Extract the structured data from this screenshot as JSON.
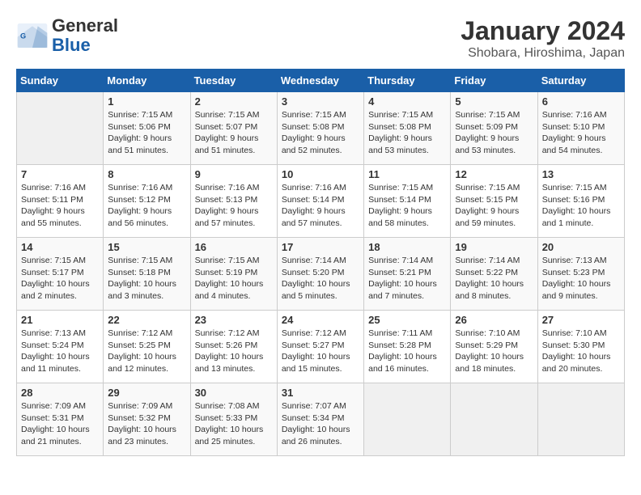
{
  "logo": {
    "text_general": "General",
    "text_blue": "Blue"
  },
  "title": "January 2024",
  "location": "Shobara, Hiroshima, Japan",
  "days_of_week": [
    "Sunday",
    "Monday",
    "Tuesday",
    "Wednesday",
    "Thursday",
    "Friday",
    "Saturday"
  ],
  "weeks": [
    [
      {
        "day": "",
        "sunrise": "",
        "sunset": "",
        "daylight": ""
      },
      {
        "day": "1",
        "sunrise": "Sunrise: 7:15 AM",
        "sunset": "Sunset: 5:06 PM",
        "daylight": "Daylight: 9 hours and 51 minutes."
      },
      {
        "day": "2",
        "sunrise": "Sunrise: 7:15 AM",
        "sunset": "Sunset: 5:07 PM",
        "daylight": "Daylight: 9 hours and 51 minutes."
      },
      {
        "day": "3",
        "sunrise": "Sunrise: 7:15 AM",
        "sunset": "Sunset: 5:08 PM",
        "daylight": "Daylight: 9 hours and 52 minutes."
      },
      {
        "day": "4",
        "sunrise": "Sunrise: 7:15 AM",
        "sunset": "Sunset: 5:08 PM",
        "daylight": "Daylight: 9 hours and 53 minutes."
      },
      {
        "day": "5",
        "sunrise": "Sunrise: 7:15 AM",
        "sunset": "Sunset: 5:09 PM",
        "daylight": "Daylight: 9 hours and 53 minutes."
      },
      {
        "day": "6",
        "sunrise": "Sunrise: 7:16 AM",
        "sunset": "Sunset: 5:10 PM",
        "daylight": "Daylight: 9 hours and 54 minutes."
      }
    ],
    [
      {
        "day": "7",
        "sunrise": "Sunrise: 7:16 AM",
        "sunset": "Sunset: 5:11 PM",
        "daylight": "Daylight: 9 hours and 55 minutes."
      },
      {
        "day": "8",
        "sunrise": "Sunrise: 7:16 AM",
        "sunset": "Sunset: 5:12 PM",
        "daylight": "Daylight: 9 hours and 56 minutes."
      },
      {
        "day": "9",
        "sunrise": "Sunrise: 7:16 AM",
        "sunset": "Sunset: 5:13 PM",
        "daylight": "Daylight: 9 hours and 57 minutes."
      },
      {
        "day": "10",
        "sunrise": "Sunrise: 7:16 AM",
        "sunset": "Sunset: 5:14 PM",
        "daylight": "Daylight: 9 hours and 57 minutes."
      },
      {
        "day": "11",
        "sunrise": "Sunrise: 7:15 AM",
        "sunset": "Sunset: 5:14 PM",
        "daylight": "Daylight: 9 hours and 58 minutes."
      },
      {
        "day": "12",
        "sunrise": "Sunrise: 7:15 AM",
        "sunset": "Sunset: 5:15 PM",
        "daylight": "Daylight: 9 hours and 59 minutes."
      },
      {
        "day": "13",
        "sunrise": "Sunrise: 7:15 AM",
        "sunset": "Sunset: 5:16 PM",
        "daylight": "Daylight: 10 hours and 1 minute."
      }
    ],
    [
      {
        "day": "14",
        "sunrise": "Sunrise: 7:15 AM",
        "sunset": "Sunset: 5:17 PM",
        "daylight": "Daylight: 10 hours and 2 minutes."
      },
      {
        "day": "15",
        "sunrise": "Sunrise: 7:15 AM",
        "sunset": "Sunset: 5:18 PM",
        "daylight": "Daylight: 10 hours and 3 minutes."
      },
      {
        "day": "16",
        "sunrise": "Sunrise: 7:15 AM",
        "sunset": "Sunset: 5:19 PM",
        "daylight": "Daylight: 10 hours and 4 minutes."
      },
      {
        "day": "17",
        "sunrise": "Sunrise: 7:14 AM",
        "sunset": "Sunset: 5:20 PM",
        "daylight": "Daylight: 10 hours and 5 minutes."
      },
      {
        "day": "18",
        "sunrise": "Sunrise: 7:14 AM",
        "sunset": "Sunset: 5:21 PM",
        "daylight": "Daylight: 10 hours and 7 minutes."
      },
      {
        "day": "19",
        "sunrise": "Sunrise: 7:14 AM",
        "sunset": "Sunset: 5:22 PM",
        "daylight": "Daylight: 10 hours and 8 minutes."
      },
      {
        "day": "20",
        "sunrise": "Sunrise: 7:13 AM",
        "sunset": "Sunset: 5:23 PM",
        "daylight": "Daylight: 10 hours and 9 minutes."
      }
    ],
    [
      {
        "day": "21",
        "sunrise": "Sunrise: 7:13 AM",
        "sunset": "Sunset: 5:24 PM",
        "daylight": "Daylight: 10 hours and 11 minutes."
      },
      {
        "day": "22",
        "sunrise": "Sunrise: 7:12 AM",
        "sunset": "Sunset: 5:25 PM",
        "daylight": "Daylight: 10 hours and 12 minutes."
      },
      {
        "day": "23",
        "sunrise": "Sunrise: 7:12 AM",
        "sunset": "Sunset: 5:26 PM",
        "daylight": "Daylight: 10 hours and 13 minutes."
      },
      {
        "day": "24",
        "sunrise": "Sunrise: 7:12 AM",
        "sunset": "Sunset: 5:27 PM",
        "daylight": "Daylight: 10 hours and 15 minutes."
      },
      {
        "day": "25",
        "sunrise": "Sunrise: 7:11 AM",
        "sunset": "Sunset: 5:28 PM",
        "daylight": "Daylight: 10 hours and 16 minutes."
      },
      {
        "day": "26",
        "sunrise": "Sunrise: 7:10 AM",
        "sunset": "Sunset: 5:29 PM",
        "daylight": "Daylight: 10 hours and 18 minutes."
      },
      {
        "day": "27",
        "sunrise": "Sunrise: 7:10 AM",
        "sunset": "Sunset: 5:30 PM",
        "daylight": "Daylight: 10 hours and 20 minutes."
      }
    ],
    [
      {
        "day": "28",
        "sunrise": "Sunrise: 7:09 AM",
        "sunset": "Sunset: 5:31 PM",
        "daylight": "Daylight: 10 hours and 21 minutes."
      },
      {
        "day": "29",
        "sunrise": "Sunrise: 7:09 AM",
        "sunset": "Sunset: 5:32 PM",
        "daylight": "Daylight: 10 hours and 23 minutes."
      },
      {
        "day": "30",
        "sunrise": "Sunrise: 7:08 AM",
        "sunset": "Sunset: 5:33 PM",
        "daylight": "Daylight: 10 hours and 25 minutes."
      },
      {
        "day": "31",
        "sunrise": "Sunrise: 7:07 AM",
        "sunset": "Sunset: 5:34 PM",
        "daylight": "Daylight: 10 hours and 26 minutes."
      },
      {
        "day": "",
        "sunrise": "",
        "sunset": "",
        "daylight": ""
      },
      {
        "day": "",
        "sunrise": "",
        "sunset": "",
        "daylight": ""
      },
      {
        "day": "",
        "sunrise": "",
        "sunset": "",
        "daylight": ""
      }
    ]
  ]
}
